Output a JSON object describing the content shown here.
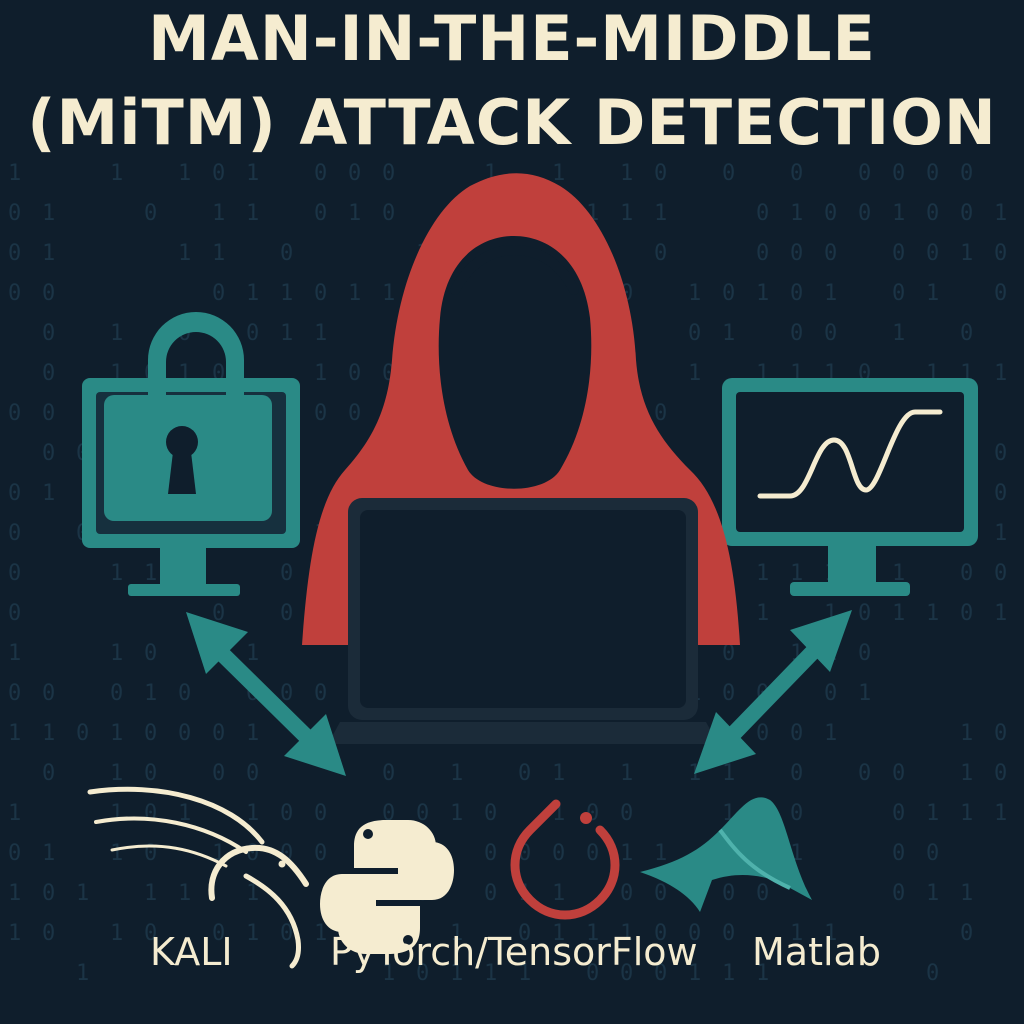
{
  "title": {
    "line1": "MAN-IN-THE-MIDDLE",
    "line2": "(MiTM) ATTACK DETECTION"
  },
  "tools": {
    "kali": "KALI",
    "frameworks": "PyTorch/TensorFlow",
    "matlab": "Matlab"
  },
  "colors": {
    "background": "#0f1e2c",
    "teal": "#2a8a86",
    "red": "#c0403c",
    "cream": "#f5ecd0",
    "binary_text": "#1b3446"
  },
  "icons": {
    "left": "padlock-monitor-icon",
    "center": "hooded-hacker-laptop-icon",
    "right": "chart-monitor-icon",
    "arrows": "double-headed-arrow-icon",
    "kali": "kali-dragon-icon",
    "python": "python-logo-icon",
    "pytorch": "pytorch-logo-icon",
    "matlab": "matlab-logo-icon"
  }
}
